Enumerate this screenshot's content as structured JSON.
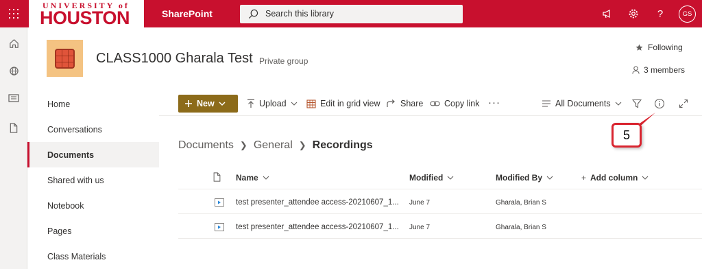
{
  "suite": {
    "logo_top": "UNIVERSITY of",
    "logo_bottom": "HOUSTON",
    "app_title": "SharePoint",
    "search_placeholder": "Search this library",
    "user_initials": "GS",
    "icons": [
      "waffle-icon",
      "megaphone-icon",
      "gear-icon",
      "help-icon"
    ]
  },
  "rail": {
    "icons": [
      "home-icon",
      "globe-icon",
      "news-icon",
      "document-icon"
    ]
  },
  "site": {
    "title": "CLASS1000 Gharala Test",
    "group_type": "Private group",
    "following_label": "Following",
    "members_label": "3 members"
  },
  "nav": {
    "items": [
      "Home",
      "Conversations",
      "Documents",
      "Shared with us",
      "Notebook",
      "Pages",
      "Class Materials"
    ],
    "active_index": 2
  },
  "commands": {
    "new_label": "New",
    "upload_label": "Upload",
    "grid_view_label": "Edit in grid view",
    "share_label": "Share",
    "copy_link_label": "Copy link",
    "more_label": "···",
    "view_label": "All Documents"
  },
  "callout": {
    "number": "5"
  },
  "breadcrumb": [
    "Documents",
    "General",
    "Recordings"
  ],
  "table": {
    "headers": {
      "name": "Name",
      "modified": "Modified",
      "modified_by": "Modified By",
      "add_column": "Add column"
    },
    "rows": [
      {
        "name": "test presenter_attendee access-20210607_1...",
        "modified": "June 7",
        "modified_by": "Gharala, Brian S"
      },
      {
        "name": "test presenter_attendee access-20210607_1...",
        "modified": "June 7",
        "modified_by": "Gharala, Brian S"
      }
    ]
  },
  "colors": {
    "brand_red": "#c8102e",
    "new_button": "#8c6b1a",
    "callout_border": "#d9242f"
  }
}
